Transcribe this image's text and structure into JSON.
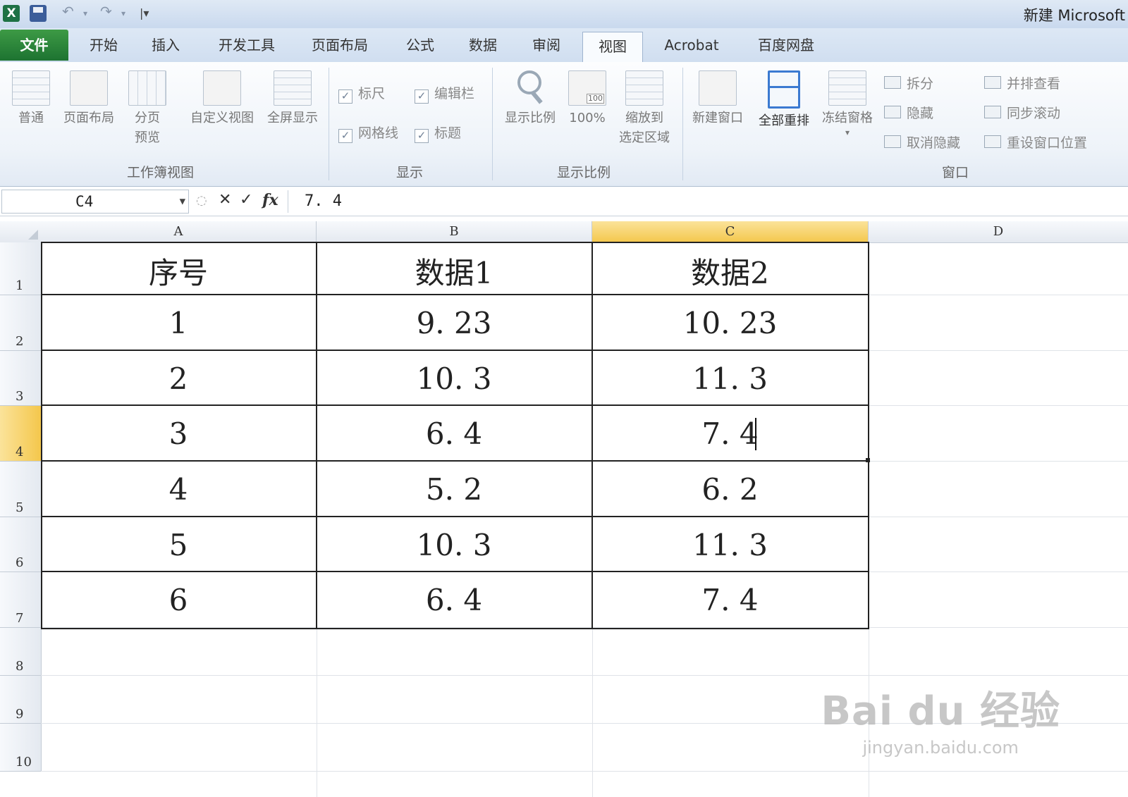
{
  "window": {
    "title": "新建 Microsoft"
  },
  "quick_access": {
    "icons": [
      "excel-logo",
      "save-icon",
      "undo-icon",
      "redo-icon",
      "customize-icon"
    ]
  },
  "tabs": [
    {
      "label": "文件",
      "active": false
    },
    {
      "label": "开始",
      "active": false
    },
    {
      "label": "插入",
      "active": false
    },
    {
      "label": "开发工具",
      "active": false
    },
    {
      "label": "页面布局",
      "active": false
    },
    {
      "label": "公式",
      "active": false
    },
    {
      "label": "数据",
      "active": false
    },
    {
      "label": "审阅",
      "active": false
    },
    {
      "label": "视图",
      "active": true
    },
    {
      "label": "Acrobat",
      "active": false
    },
    {
      "label": "百度网盘",
      "active": false
    }
  ],
  "ribbon": {
    "workbook_views": {
      "label": "工作簿视图",
      "normal": "普通",
      "page_layout": "页面布局",
      "page_break_1": "分页",
      "page_break_2": "预览",
      "custom_views": "自定义视图",
      "full_screen": "全屏显示"
    },
    "show": {
      "label": "显示",
      "ruler": "标尺",
      "formula_bar": "编辑栏",
      "gridlines": "网格线",
      "headings": "标题"
    },
    "zoom": {
      "label": "显示比例",
      "zoom": "显示比例",
      "hundred": "100%",
      "hundred_icon_text": "100",
      "to_selection_1": "缩放到",
      "to_selection_2": "选定区域"
    },
    "window": {
      "label": "窗口",
      "new_window": "新建窗口",
      "arrange_all": "全部重排",
      "freeze_panes": "冻结窗格",
      "split": "拆分",
      "hide": "隐藏",
      "unhide": "取消隐藏",
      "side_by_side": "并排查看",
      "sync_scroll": "同步滚动",
      "reset_position": "重设窗口位置"
    }
  },
  "formula_bar": {
    "name_box": "C4",
    "value": "7. 4"
  },
  "sheet": {
    "columns": [
      "A",
      "B",
      "C",
      "D"
    ],
    "rows": [
      "1",
      "2",
      "3",
      "4",
      "5",
      "6",
      "7",
      "8",
      "9",
      "10"
    ],
    "active_cell": "C4",
    "header": [
      "序号",
      "数据1",
      "数据2"
    ],
    "data": [
      [
        "1",
        "9. 23",
        "10. 23"
      ],
      [
        "2",
        "10. 3",
        "11. 3"
      ],
      [
        "3",
        "6. 4",
        "7. 4"
      ],
      [
        "4",
        "5. 2",
        "6. 2"
      ],
      [
        "5",
        "10. 3",
        "11. 3"
      ],
      [
        "6",
        "6. 4",
        "7. 4"
      ]
    ]
  },
  "watermark": {
    "main": "Bai du 经验",
    "sub": "jingyan.baidu.com"
  }
}
